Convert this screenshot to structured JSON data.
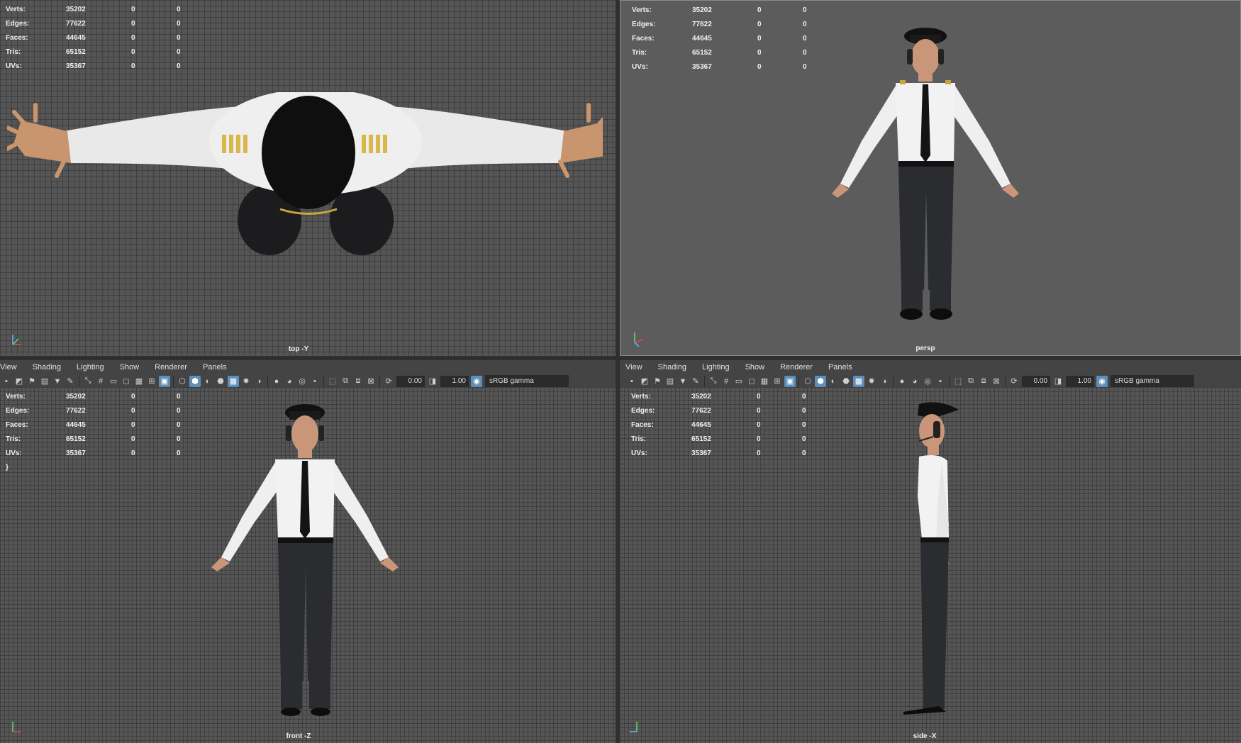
{
  "stats": [
    {
      "label": "Verts:",
      "v1": "35202",
      "v2": "0",
      "v3": "0"
    },
    {
      "label": "Edges:",
      "v1": "77622",
      "v2": "0",
      "v3": "0"
    },
    {
      "label": "Faces:",
      "v1": "44645",
      "v2": "0",
      "v3": "0"
    },
    {
      "label": "Tris:",
      "v1": "65152",
      "v2": "0",
      "v3": "0"
    },
    {
      "label": "UVs:",
      "v1": "35367",
      "v2": "0",
      "v3": "0"
    }
  ],
  "viewports": {
    "top": {
      "camera": "top -Y"
    },
    "persp": {
      "camera": "persp"
    },
    "front": {
      "camera": "front -Z"
    },
    "side": {
      "camera": "side -X"
    }
  },
  "menu": [
    "View",
    "Shading",
    "Lighting",
    "Show",
    "Renderer",
    "Panels"
  ],
  "toolbar": {
    "exposure": "0.00",
    "gamma": "1.00",
    "color_space": "sRGB gamma"
  },
  "axis": {
    "x": "x",
    "y": "y",
    "z": "z"
  },
  "colors": {
    "viewport_bg": "#5c5c5c",
    "panel_bg": "#444444",
    "active_icon": "#5d8fb8",
    "stat_text": "#f0f0f0"
  }
}
